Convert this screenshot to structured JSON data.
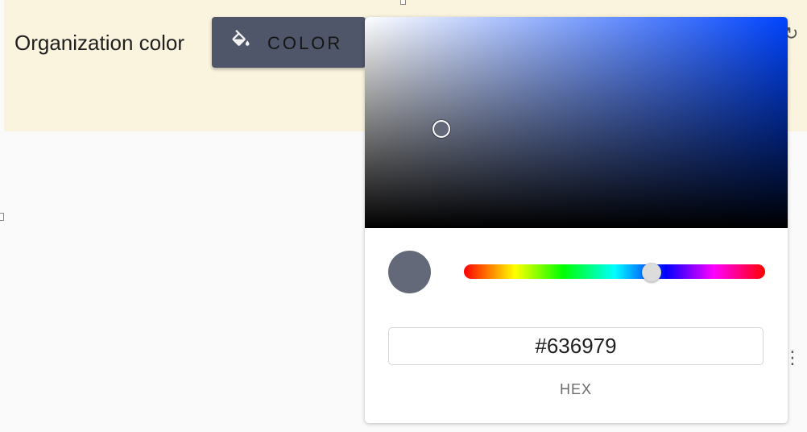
{
  "settings": {
    "field_label": "Organization color",
    "color_button_label": "COLOR",
    "color_button_icon": "paint-bucket-icon"
  },
  "color_picker": {
    "hex_value": "#636979",
    "format_label": "HEX",
    "current_color": "#636979",
    "hue_color": "#0044ff",
    "hue_fraction": 0.62,
    "saturation_fraction": 0.18,
    "brightness_fraction": 0.47
  }
}
